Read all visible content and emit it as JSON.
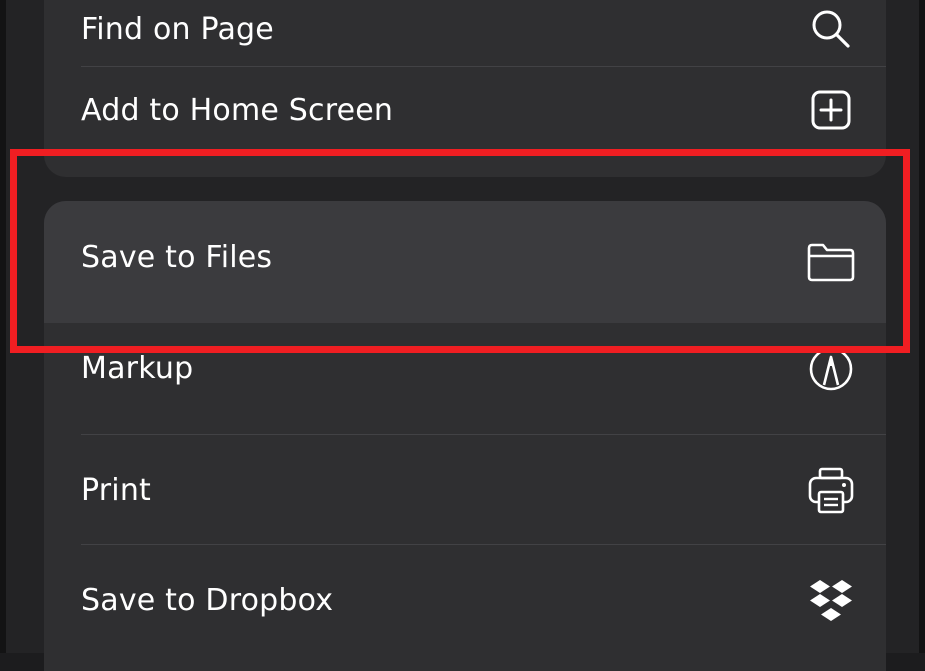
{
  "menu": {
    "top_group": [
      {
        "label": "Find on Page",
        "icon": "search-icon"
      },
      {
        "label": "Add to Home Screen",
        "icon": "plus-square-icon"
      }
    ],
    "bottom_group": [
      {
        "label": "Save to Files",
        "icon": "folder-icon",
        "highlighted": true
      },
      {
        "label": "Markup",
        "icon": "markup-pen-icon"
      },
      {
        "label": "Print",
        "icon": "printer-icon"
      },
      {
        "label": "Save to Dropbox",
        "icon": "dropbox-icon"
      }
    ]
  },
  "colors": {
    "background": "#232325",
    "row_background": "#2f2f31",
    "highlighted_row": "#3b3b3e",
    "annotation_box": "#f01e22"
  }
}
